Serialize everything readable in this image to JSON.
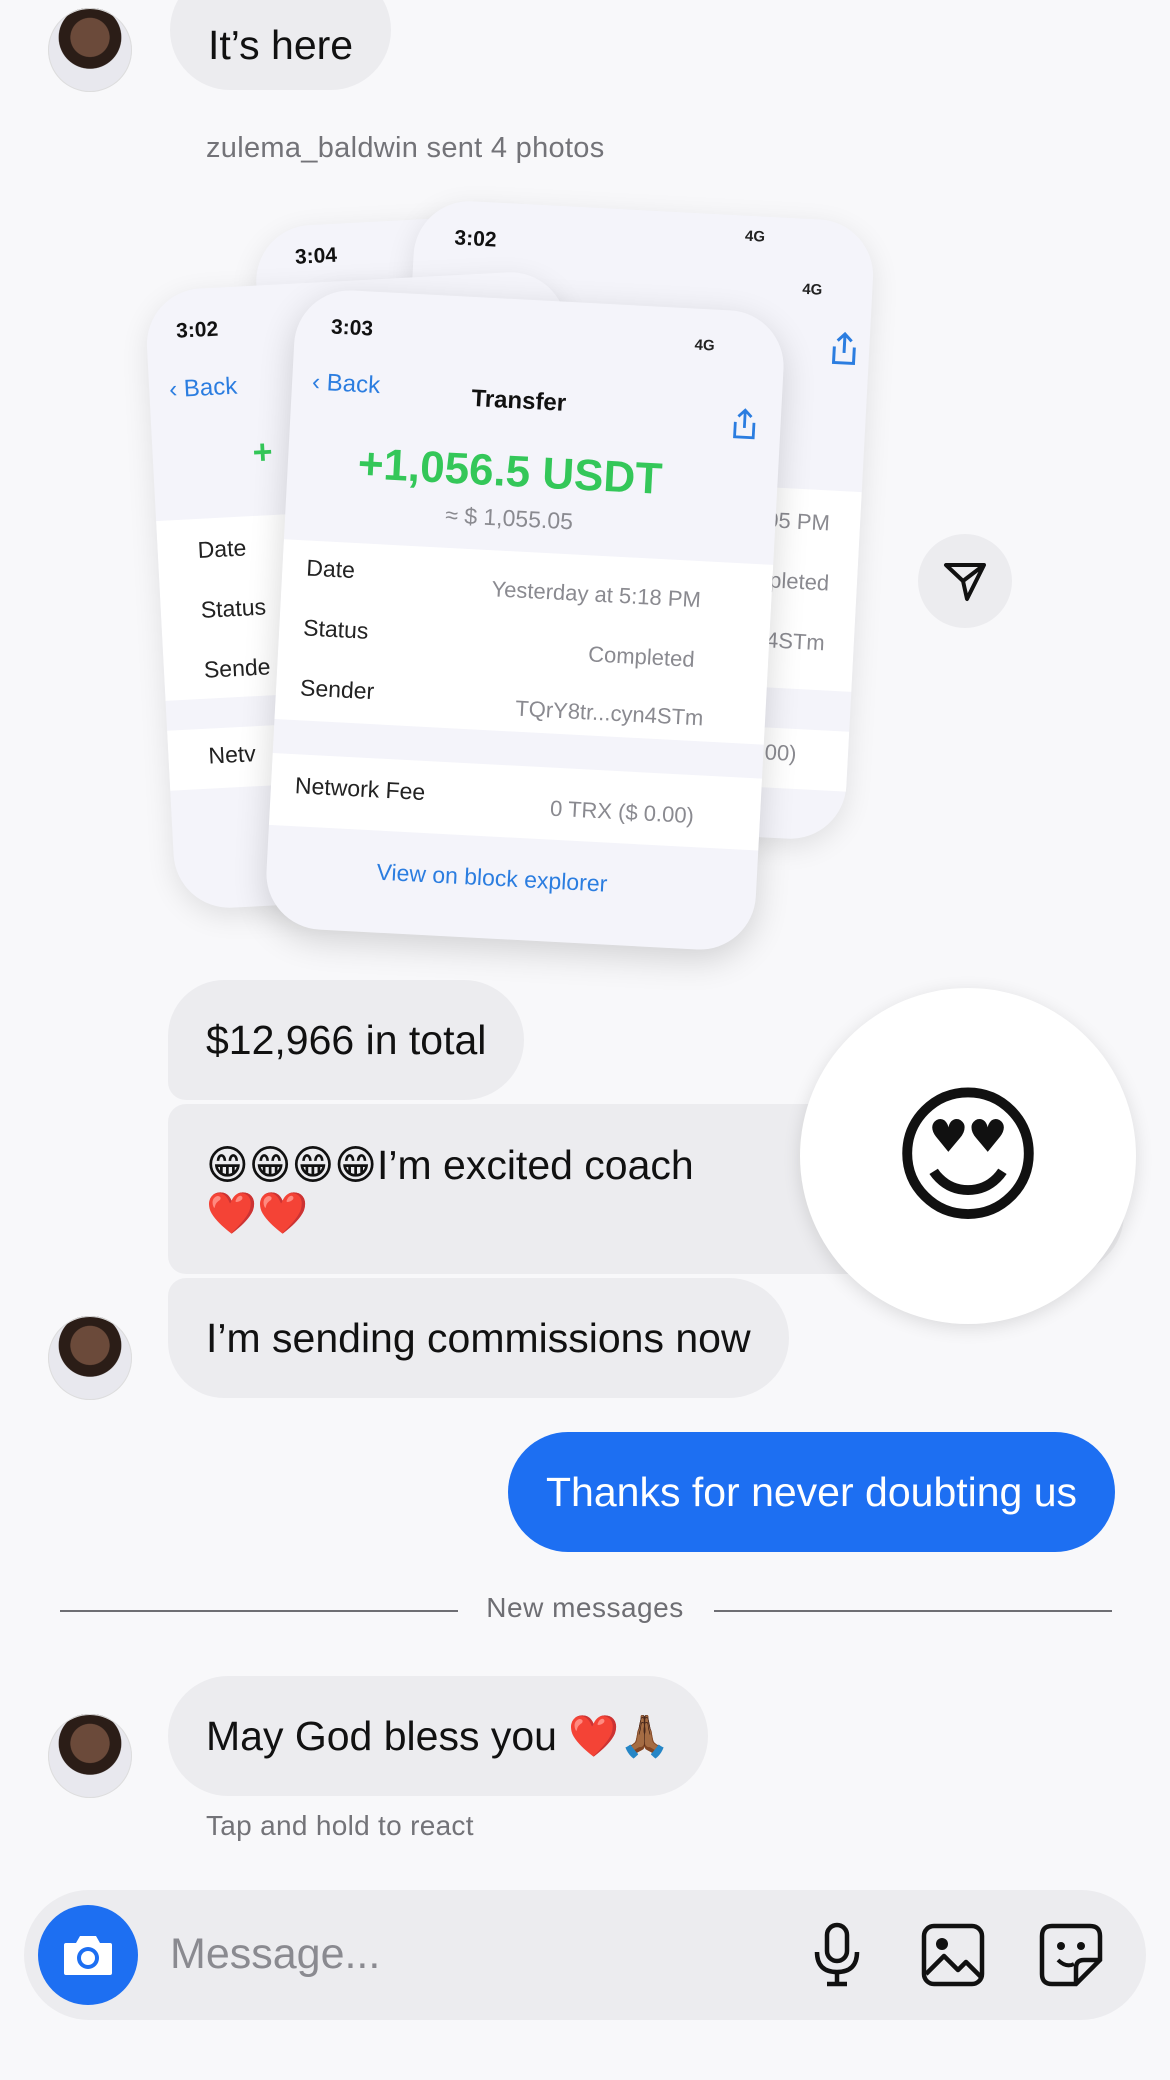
{
  "messages": {
    "m1": "It’s here",
    "sent_photos_note": "zulema_baldwin sent 4 photos",
    "m2": "$12,966 in total",
    "m3_line1": "😁😁😁😁I’m excited coach",
    "m3_line2": "❤️❤️",
    "m4": "I’m sending commissions now",
    "m5_out": "Thanks for never doubting us",
    "new_messages": "New messages",
    "m6": "May God bless you ❤️🙏🏾",
    "hint": "Tap and hold to react"
  },
  "reaction_emoji": "😍",
  "photos": {
    "front": {
      "time": "3:03",
      "signal": "4G",
      "back": "Back",
      "title": "Transfer",
      "amount": "+1,056.5 USDT",
      "fiat": "≈ $ 1,055.05",
      "rows": [
        {
          "label": "Date",
          "value": "Yesterday at 5:18 PM"
        },
        {
          "label": "Status",
          "value": "Completed"
        },
        {
          "label": "Sender",
          "value": "TQrY8tr...cyn4STm"
        }
      ],
      "fee_label": "Network Fee",
      "fee_value": "0 TRX ($ 0.00)",
      "explorer": "View on block explorer"
    },
    "left": {
      "time": "3:02",
      "back": "Back",
      "amount_peek": "+",
      "rows": [
        "Date",
        "Status",
        "Sende"
      ],
      "fee_peek": "Netv"
    },
    "back_left": {
      "time": "3:04"
    },
    "back_right": {
      "time": "3:02",
      "signal": "4G",
      "values": [
        ":05 PM",
        "npleted",
        "n4STm",
        "$ 0.00)"
      ]
    },
    "middle": {
      "signal": "4G"
    }
  },
  "composer": {
    "placeholder": "Message...",
    "icons": [
      "camera-icon",
      "microphone-icon",
      "gallery-icon",
      "sticker-icon"
    ]
  },
  "colors": {
    "accent": "#1d6ff2",
    "received_bubble": "#ececef",
    "amount_green": "#34c759"
  }
}
